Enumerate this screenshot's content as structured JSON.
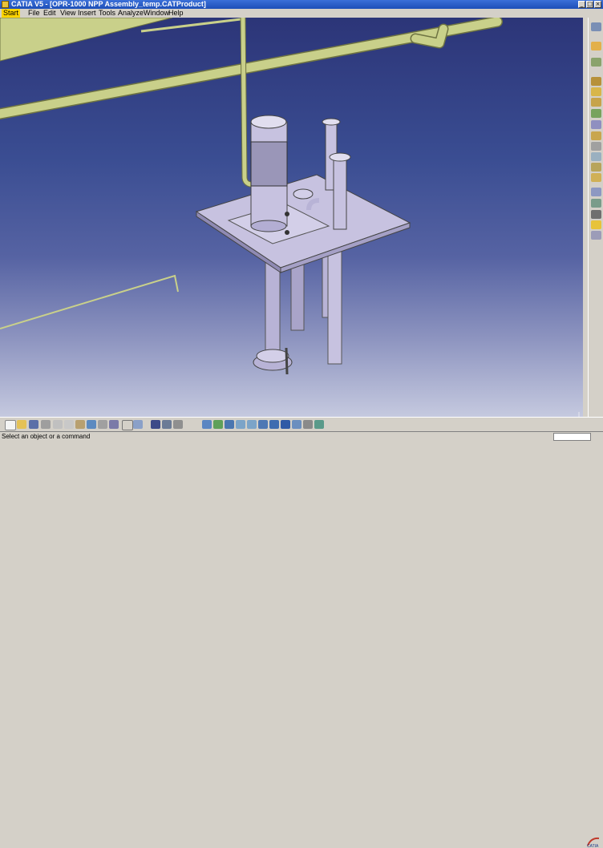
{
  "window": {
    "title": "CATIA V5 - [OPR-1000 NPP Assembly_temp.CATProduct]"
  },
  "menu": {
    "items": [
      "Start",
      "File",
      "Edit",
      "View",
      "Insert",
      "Tools",
      "Analyze",
      "Window",
      "Help"
    ]
  },
  "status": {
    "message": "Select an object or a command"
  },
  "colors": {
    "pipe": "#c9d08a",
    "pump_body": "#c7c2e0",
    "background_top": "#2c3578",
    "background_bottom": "#c5c9df"
  },
  "icons": {
    "right_toolbar": [
      "axis-system-icon",
      "sketch-icon",
      "product-icon",
      "component-icon",
      "part-icon",
      "existing-component-icon",
      "replace-icon",
      "graph-tree-icon",
      "generate-numbering-icon",
      "selective-load-icon",
      "manage-representations-icon",
      "fast-multi-instantiation-icon",
      "bill-of-material-icon",
      "publication-icon",
      "constraint-icon",
      "fix-icon",
      "manipulate-icon",
      "snap-icon",
      "bulb-icon",
      "catalog-icon"
    ],
    "bottom_toolbar": [
      "new-icon",
      "open-icon",
      "save-icon",
      "print-icon",
      "cut-icon",
      "copy-icon",
      "paste-icon",
      "undo-icon",
      "redo-icon",
      "whats-this-icon",
      "formula-icon",
      "catalog-browser-icon",
      "spec-tree-icon",
      "analysis-icon",
      "pan-icon",
      "fit-all-icon",
      "rotate-icon",
      "zoom-in-icon",
      "zoom-out-icon",
      "normal-view-icon",
      "view-mode-icon",
      "render-style-icon",
      "hide-show-icon",
      "swap-space-icon",
      "measure-icon"
    ]
  }
}
